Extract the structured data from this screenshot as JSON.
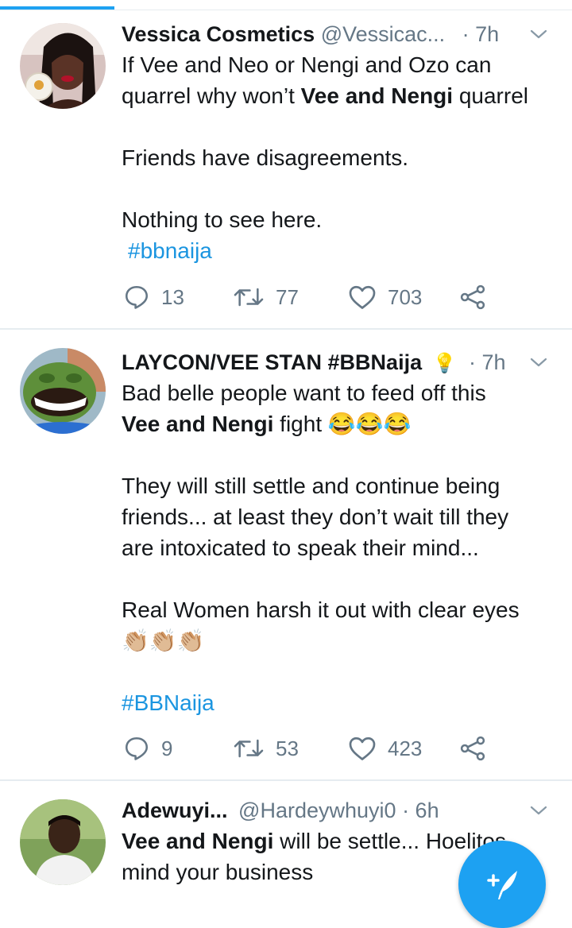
{
  "tweets": [
    {
      "name": "Vessica Cosmetics",
      "handle": "@Vessicac...",
      "time": "· 7h",
      "body": {
        "line1": "If Vee and Neo or Nengi and Ozo can",
        "line2_pre": "quarrel why won’t ",
        "line2_bold": "Vee and Nengi",
        "line2_post": " quarrel",
        "para2": "Friends have disagreements.",
        "para3": "Nothing to see here.",
        "hashtag": "#bbnaija"
      },
      "replies": "13",
      "retweets": "77",
      "likes": "703"
    },
    {
      "name": "LAYCON/VEE STAN #BBNaija",
      "name_emoji": "💡",
      "time": "· 7h",
      "body": {
        "line1": "Bad belle people want to feed off this",
        "line2_bold": "Vee and Nengi",
        "line2_post": " fight 😂😂😂",
        "para2_line1": "They will still settle and continue being",
        "para2_line2": "friends... at least they don’t wait till they",
        "para2_line3": "are intoxicated to speak their mind...",
        "para3_line1": "Real Women harsh it out with clear eyes",
        "para3_emoji": "👏🏼👏🏼👏🏼",
        "hashtag": "#BBNaija"
      },
      "replies": "9",
      "retweets": "53",
      "likes": "423"
    },
    {
      "name": "Adewuyi...",
      "handle": "@Hardeywhuyi0",
      "time": "· 6h",
      "body": {
        "line1_bold": "Vee and Nengi",
        "line1_post": " will be settle... Hoelitos",
        "line2": "mind your business"
      }
    }
  ],
  "icons": {
    "reply": "reply-icon",
    "retweet": "retweet-icon",
    "like": "heart-icon",
    "share": "share-icon",
    "caret": "chevron-down-icon",
    "compose": "compose-tweet-icon"
  },
  "colors": {
    "accent": "#1da1f2",
    "hashtag": "#1b95e0",
    "secondary_text": "#657786",
    "divider": "#e6ecf0"
  }
}
